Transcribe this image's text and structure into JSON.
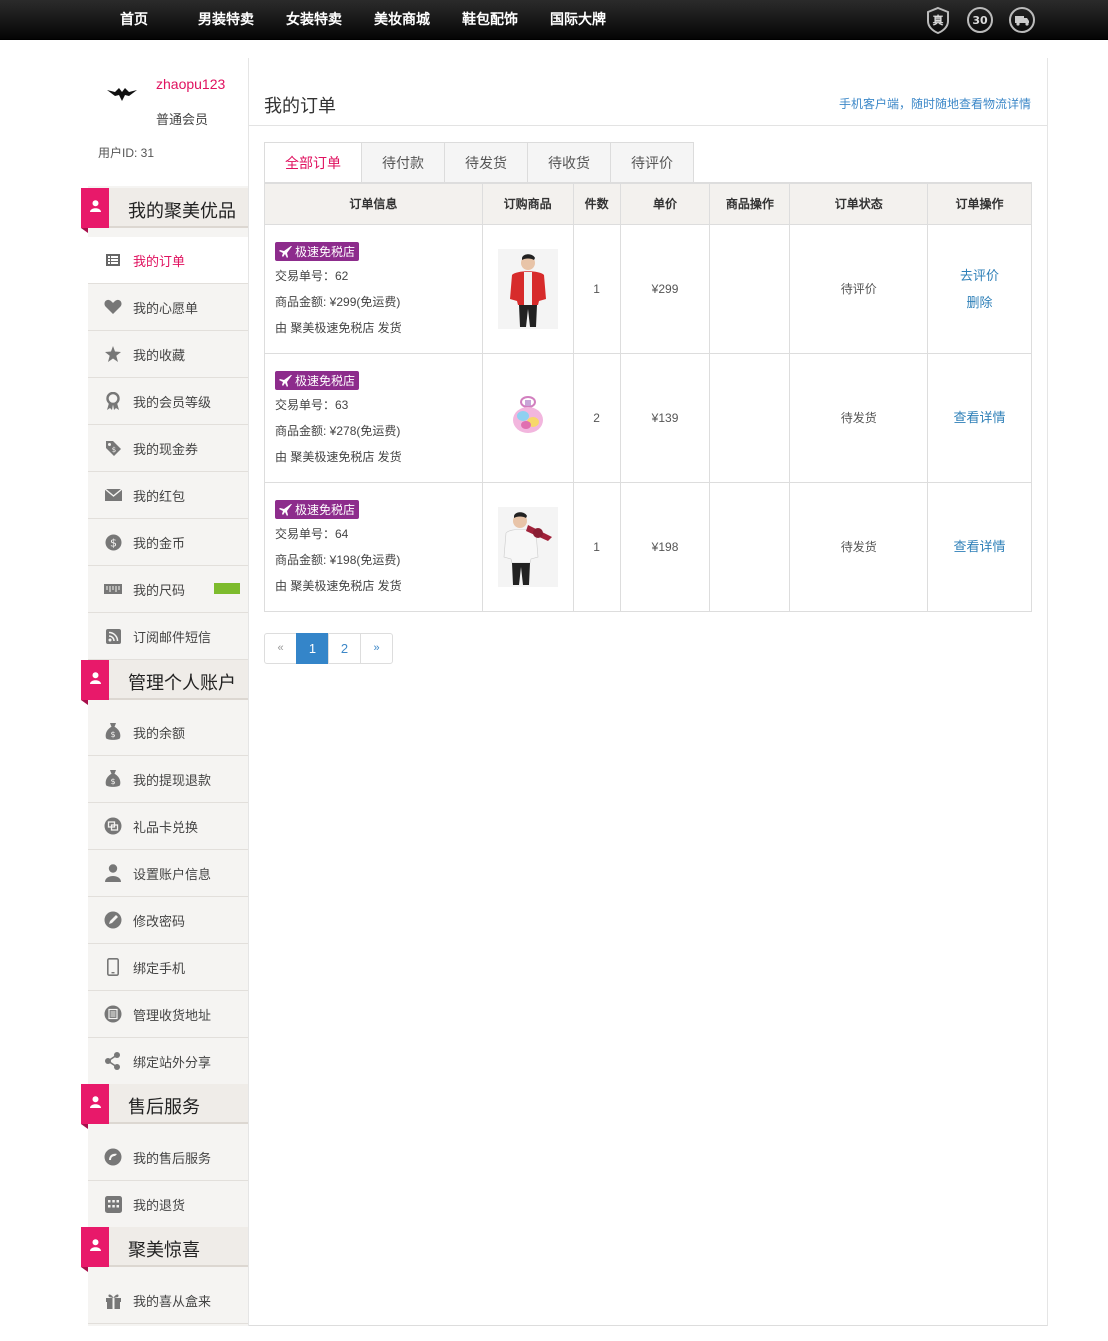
{
  "topnav": [
    "首页",
    "男装特卖",
    "女装特卖",
    "美妆商城",
    "鞋包配饰",
    "国际大牌"
  ],
  "trust_icons": [
    "authentic-icon",
    "30-day-return-icon",
    "delivery-icon"
  ],
  "user": {
    "name": "zhaopu123",
    "level": "普通会员",
    "id_text": "用户ID: 31"
  },
  "sections": [
    {
      "title": "我的聚美优品",
      "items": [
        "我的订单",
        "我的心愿单",
        "我的收藏",
        "我的会员等级",
        "我的现金券",
        "我的红包",
        "我的金币",
        "我的尺码",
        "订阅邮件短信"
      ]
    },
    {
      "title": "管理个人账户",
      "items": [
        "我的余额",
        "我的提现退款",
        "礼品卡兑换",
        "设置账户信息",
        "修改密码",
        "绑定手机",
        "管理收货地址",
        "绑定站外分享"
      ]
    },
    {
      "title": "售后服务",
      "items": [
        "我的售后服务",
        "我的退货"
      ]
    },
    {
      "title": "聚美惊喜",
      "items": [
        "我的喜从盒来"
      ]
    }
  ],
  "main": {
    "title": "我的订单",
    "mobile_link": "手机客户端，随时随地查看物流详情",
    "tabs": [
      "全部订单",
      "待付款",
      "待发货",
      "待收货",
      "待评价"
    ],
    "columns": [
      "订单信息",
      "订购商品",
      "件数",
      "单价",
      "商品操作",
      "订单状态",
      "订单操作"
    ],
    "orders": [
      {
        "store_tag": "极速免税店",
        "order_no": "交易单号：62",
        "amount": "商品金额: ¥299(免运费)",
        "shipper": "由 聚美极速免税店 发货",
        "qty": "1",
        "price": "¥299",
        "status": "待评价",
        "actions": [
          "去评价",
          "删除"
        ]
      },
      {
        "store_tag": "极速免税店",
        "order_no": "交易单号：63",
        "amount": "商品金额: ¥278(免运费)",
        "shipper": "由 聚美极速免税店 发货",
        "qty": "2",
        "price": "¥139",
        "status": "待发货",
        "actions": [
          "查看详情"
        ]
      },
      {
        "store_tag": "极速免税店",
        "order_no": "交易单号：64",
        "amount": "商品金额: ¥198(免运费)",
        "shipper": "由 聚美极速免税店 发货",
        "qty": "1",
        "price": "¥198",
        "status": "待发货",
        "actions": [
          "查看详情"
        ]
      }
    ],
    "pager": {
      "prev": "«",
      "pages": [
        "1",
        "2"
      ],
      "current": "1",
      "next": "»"
    }
  },
  "colors": {
    "brand_pink": "#e0115f",
    "link_blue": "#2f80b8",
    "store_tag_purple": "#8d2c8c"
  }
}
